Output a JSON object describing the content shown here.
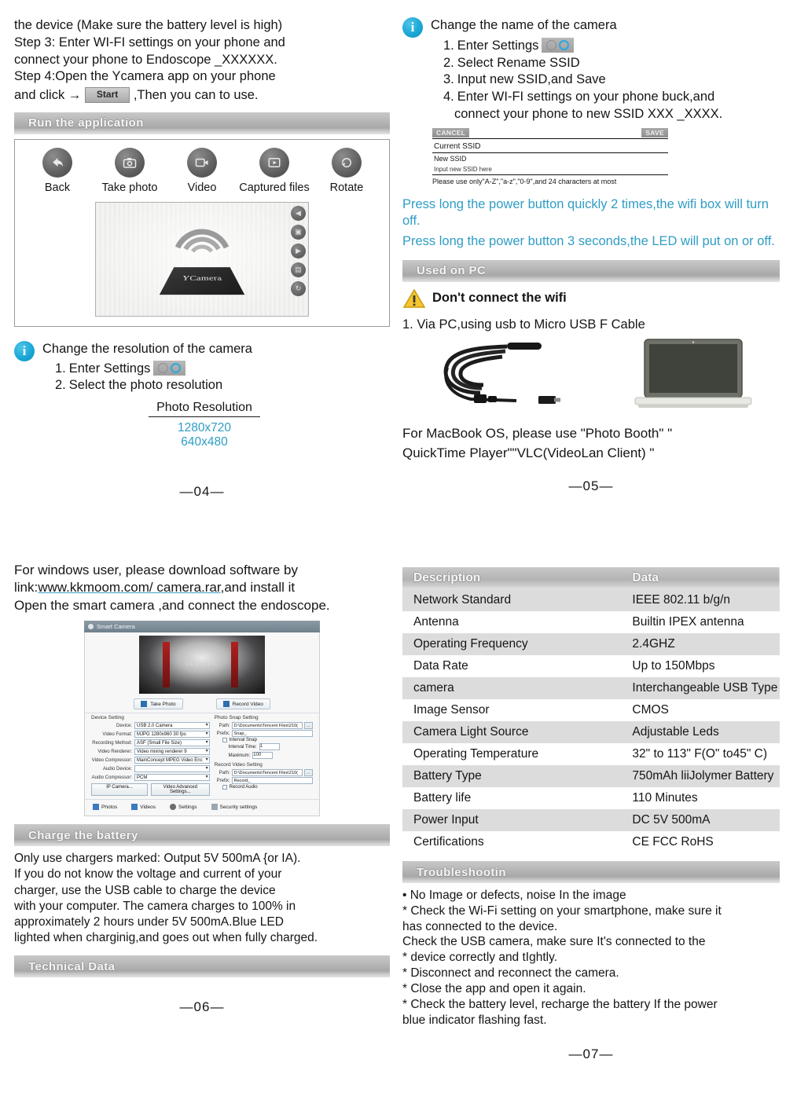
{
  "pages": {
    "p04": {
      "number": "—04—",
      "intro_lines": [
        "the device (Make sure the battery level is high)",
        "Step 3: Enter WI-FI settings on your phone and",
        "connect your phone to Endoscope _XXXXXX.",
        "Step 4:Open the Ycamera app on your phone"
      ],
      "step4_prefix": "and click",
      "arrow": "→",
      "start_button": "Start",
      "step4_suffix": ",Then you can to use.",
      "banner": "Run the application",
      "toolbar": [
        {
          "label": "Back",
          "icon": "back-arrow-icon",
          "glyph": "◀"
        },
        {
          "label": "Take photo",
          "icon": "camera-icon",
          "glyph": "▣"
        },
        {
          "label": "Video",
          "icon": "video-camera-icon",
          "glyph": "▤"
        },
        {
          "label": "Captured files",
          "icon": "media-files-icon",
          "glyph": "▶"
        },
        {
          "label": "Rotate",
          "icon": "rotate-icon",
          "glyph": "↻"
        }
      ],
      "preview_app_name": "YCamera",
      "preview_side_icons": [
        "back-arrow-icon",
        "camera-icon",
        "video-camera-icon",
        "media-files-icon",
        "rotate-icon"
      ],
      "info_title": "Change the resolution of the camera",
      "info_steps": [
        {
          "num": "1.",
          "text": "Enter Settings",
          "chip": true
        },
        {
          "num": "2.",
          "text": "Select the photo resolution",
          "chip": false
        }
      ],
      "resolution_header": "Photo Resolution",
      "resolutions": [
        "1280x720",
        "640x480"
      ]
    },
    "p05": {
      "number": "—05—",
      "info_title": "Change the name of the camera",
      "info_steps": [
        {
          "num": "1.",
          "text": "Enter Settings",
          "chip": true
        },
        {
          "num": "2.",
          "text": "Select Rename SSID",
          "chip": false
        },
        {
          "num": "3.",
          "text": "Input new SSID,and Save",
          "chip": false
        },
        {
          "num": "4.",
          "text": "Enter WI-FI settings on your phone buck,and",
          "chip": false
        },
        {
          "num": "",
          "text": "connect your phone to new SSID XXX _XXXX.",
          "chip": false
        }
      ],
      "ssid_mock": {
        "cancel": "CANCEL",
        "save": "SAVE",
        "current_label": "Current SSID",
        "new_label": "New SSID",
        "new_placeholder": "Input new SSID here",
        "note": "Please use only\"A-Z\",\"a-z\",\"0-9\",and 24 characters at most"
      },
      "cyan_notes": [
        "Press long the power button quickly 2 times,the wifi box will turn off.",
        "Press long the power button 3 seconds,the LED will put on or off."
      ],
      "banner": "Used on PC",
      "warning": "Don't connect the wifi",
      "warning_bold_part": "connect the wifi",
      "pc_step": "1. Via PC,using usb to Micro USB F Cable",
      "mac_note_lines": [
        "For MacBook OS, please use \"Photo Booth\" \"",
        "QuickTime Player\"\"VLC(VideoLan Client) \""
      ]
    },
    "p06": {
      "number": "—06—",
      "intro_lines": [
        "For windows user, please download software by",
        "Open the smart camera ,and connect the endoscope."
      ],
      "link_prefix": "link:",
      "link_text": "www.kkmoom.com/ camera.rar",
      "link_suffix": ",and install it",
      "smart_camera": {
        "title": "Smart Camera",
        "photo_caption": "V8 4.2 FSI",
        "buttons": [
          {
            "label": "Take Photo",
            "icon": "photo-icon"
          },
          {
            "label": "Record Video",
            "icon": "video-icon"
          }
        ],
        "device_setting_group": "Device Setting",
        "device_fields": [
          {
            "label": "Device:",
            "value": "USB 2.0 Camera"
          },
          {
            "label": "Video Format:",
            "value": "MJPG 1280x960 30 fps"
          },
          {
            "label": "Recording Method:",
            "value": "ASF (Small File Size)"
          },
          {
            "label": "Video Renderer:",
            "value": "Video mixing renderer 9"
          },
          {
            "label": "Video Compressor:",
            "value": "MainConcept MPEG Video Enc"
          },
          {
            "label": "Audio Device:",
            "value": ""
          },
          {
            "label": "Audio Compressor:",
            "value": "PCM"
          }
        ],
        "device_buttons": [
          "IP Camera...",
          "Video Advanced Settings..."
        ],
        "photo_snap_group": "Photo Snap Setting",
        "photo_path_label": "Path:",
        "photo_path_value": "D:\\Documents\\Tencent Files\\210(",
        "photo_prefix_label": "Prefix:",
        "photo_prefix_value": "Snap_",
        "interval_snap": "Interval Snap",
        "interval_time_label": "Interval Time:",
        "interval_time_value": "1",
        "maximum_label": "Maximum:",
        "maximum_value": "100",
        "record_group": "Record Video Setting",
        "record_path_label": "Path:",
        "record_path_value": "D:\\Documents\\Tencent Files\\210(",
        "record_prefix_label": "Prefix:",
        "record_prefix_value": "Record_",
        "record_audio": "Record Audio",
        "footer": [
          {
            "label": "Photos",
            "icon": "photos-icon"
          },
          {
            "label": "Videos",
            "icon": "videos-icon"
          },
          {
            "label": "Settings",
            "icon": "settings-icon"
          },
          {
            "label": "Security settings",
            "icon": "security-icon"
          }
        ]
      },
      "banner_charge": "Charge the battery",
      "charge_lines": [
        "Only use chargers marked: Output 5V 500mA {or IA).",
        "If you do not know the voltage and current of your",
        "charger, use the USB cable to charge the device",
        "with your computer. The camera charges to 100% in",
        "approximately 2 hours under 5V 500mA.Blue LED",
        "lighted when charginig,and goes out when fully charged."
      ],
      "banner_tech": "Technical Data"
    },
    "p07": {
      "number": "—07—",
      "table": {
        "headers": [
          "Description",
          "Data"
        ],
        "rows": [
          [
            "Network Standard",
            "IEEE 802.11 b/g/n"
          ],
          [
            "Antenna",
            "Builtin IPEX antenna"
          ],
          [
            "Operating Frequency",
            "2.4GHZ"
          ],
          [
            "Data Rate",
            "Up to 150Mbps"
          ],
          [
            "camera",
            "Interchangeable USB Type"
          ],
          [
            "Image Sensor",
            "CMOS"
          ],
          [
            "Camera Light Source",
            "Adjustable Leds"
          ],
          [
            "Operating Temperature",
            "32\" to 113\" F(O\" to45\" C)"
          ],
          [
            "Battery Type",
            "750mAh liiJolymer Battery"
          ],
          [
            "Battery life",
            "110 Minutes"
          ],
          [
            "Power Input",
            "DC 5V 500mA"
          ],
          [
            "Certifications",
            "CE FCC RoHS"
          ]
        ]
      },
      "banner_trouble": "Troubleshootin",
      "trouble_lines": [
        "• No Image or defects, noise In the image",
        "* Check the Wi-Fi setting on your smartphone, make sure it",
        "has connected to the device.",
        "Check the USB camera, make sure It's connected to the",
        "* device correctly and tIghtly.",
        "* Disconnect and reconnect the camera.",
        "* Close the app and open it again.",
        "* Check the battery level, recharge the battery If the power",
        "blue indicator flashing fast."
      ]
    }
  },
  "colors": {
    "cyan": "#2f9dc4",
    "banner_gray": "#b4b4b4",
    "info_blue": "#1aa8d6"
  }
}
